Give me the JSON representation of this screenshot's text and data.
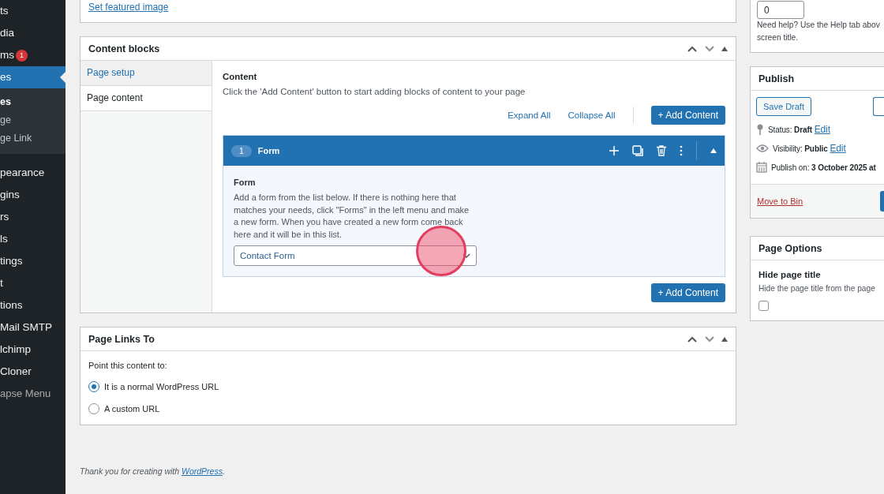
{
  "sidebar": {
    "items": [
      {
        "label": "ts",
        "kind": "menu",
        "selected": false
      },
      {
        "label": "dia",
        "kind": "menu",
        "selected": false
      },
      {
        "label": "ms",
        "kind": "menu",
        "selected": false,
        "badge": "1"
      },
      {
        "label": "es",
        "kind": "menu",
        "selected": true,
        "children": [
          {
            "label": "es",
            "selected": true
          },
          {
            "label": "ge",
            "selected": false
          },
          {
            "label": "ge Link",
            "selected": false
          }
        ]
      },
      {
        "label": "pearance",
        "kind": "menu",
        "selected": false
      },
      {
        "label": "gins",
        "kind": "menu",
        "selected": false
      },
      {
        "label": "rs",
        "kind": "menu",
        "selected": false
      },
      {
        "label": "ls",
        "kind": "menu",
        "selected": false
      },
      {
        "label": "tings",
        "kind": "menu",
        "selected": false
      },
      {
        "label": "t",
        "kind": "menu",
        "selected": false
      },
      {
        "label": "tions",
        "kind": "menu",
        "selected": false
      },
      {
        "label": "Mail SMTP",
        "kind": "menu",
        "selected": false
      },
      {
        "label": "lchimp",
        "kind": "menu",
        "selected": false
      },
      {
        "label": "Cloner",
        "kind": "menu",
        "selected": false
      },
      {
        "label": "apse Menu",
        "kind": "collapse",
        "selected": false
      }
    ]
  },
  "featured_image": {
    "link": "Set featured image"
  },
  "content_blocks": {
    "title": "Content blocks",
    "tabs": [
      {
        "label": "Page setup",
        "selected": false
      },
      {
        "label": "Page content",
        "selected": true
      }
    ],
    "heading": "Content",
    "description": "Click the 'Add Content' button to start adding blocks of content to your page",
    "expand_all": "Expand All",
    "collapse_all": "Collapse All",
    "add_button": "+ Add Content",
    "block": {
      "number": "1",
      "title": "Form",
      "field_label": "Form",
      "help": "Add a form from the list below. If there is nothing here that matches your needs, click \"Forms\" in the left menu and make a new form. When you have created a new form come back here and it will be in this list.",
      "select_value": "Contact Form"
    },
    "add_button_bottom": "+ Add Content"
  },
  "page_links": {
    "title": "Page Links To",
    "prompt": "Point this content to:",
    "options": [
      {
        "label": "It is a normal WordPress URL",
        "selected": true
      },
      {
        "label": "A custom URL",
        "selected": false
      }
    ]
  },
  "footer": {
    "text": "Thank you for creating with",
    "link": "WordPress",
    "after": "."
  },
  "order_box": {
    "value": "0",
    "help": [
      "Need help? Use the Help tab abov",
      "screen title."
    ]
  },
  "publish": {
    "title": "Publish",
    "save_draft": "Save Draft",
    "rows": [
      {
        "kind": "status",
        "text": "Status: **Draft**",
        "link": "Edit"
      },
      {
        "kind": "visibility",
        "text": "Visibility: **Public**",
        "link": "Edit"
      },
      {
        "kind": "date",
        "text": "Publish on: **3 October 2025 at**"
      }
    ],
    "move_to_bin": "Move to Bin"
  },
  "page_options": {
    "title": "Page Options",
    "option_title": "Hide page title",
    "option_desc": "Hide the page title from the page",
    "checked": false
  }
}
